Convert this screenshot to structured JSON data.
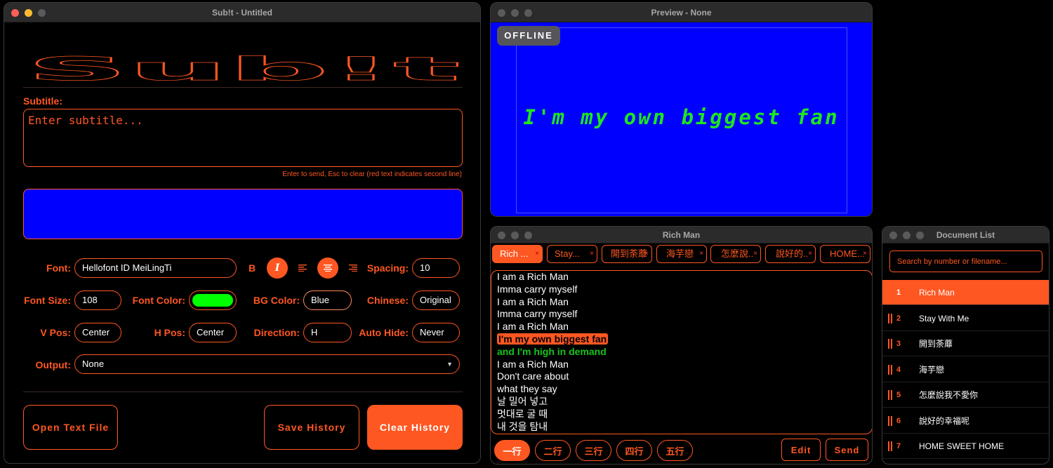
{
  "main_window": {
    "title": "Sub!t - Untitled",
    "logo_text": "Sub!t",
    "subtitle_label": "Subtitle:",
    "subtitle_placeholder": "Enter subtitle...",
    "hint": "Enter to send, Esc to clear (red text indicates second line)",
    "preview_color": "#0000ff",
    "fields": {
      "font_label": "Font:",
      "font_value": "Hellofont ID MeiLingTi",
      "bold_label": "B",
      "italic_label": "I",
      "spacing_label": "Spacing:",
      "spacing_value": "10",
      "font_size_label": "Font Size:",
      "font_size_value": "108",
      "font_color_label": "Font Color:",
      "font_color_value": "#00ff00",
      "bg_color_label": "BG Color:",
      "bg_color_value": "Blue",
      "chinese_label": "Chinese:",
      "chinese_value": "Original",
      "vpos_label": "V Pos:",
      "vpos_value": "Center",
      "hpos_label": "H Pos:",
      "hpos_value": "Center",
      "direction_label": "Direction:",
      "direction_value": "H",
      "autohide_label": "Auto Hide:",
      "autohide_value": "Never",
      "output_label": "Output:",
      "output_value": "None"
    },
    "buttons": {
      "open": "Open Text File",
      "save": "Save History",
      "clear": "Clear History"
    }
  },
  "preview_window": {
    "title": "Preview - None",
    "badge": "OFFLINE",
    "text": "I'm my own biggest fan",
    "bg_color": "#0000ff",
    "text_color": "#1ee61e"
  },
  "lyrics_window": {
    "title": "Rich Man",
    "tabs": [
      "Rich ...",
      "Stay...",
      "開到荼蘼",
      "海芋戀",
      "怎麼說..",
      "說好的..",
      "HOME..."
    ],
    "tab_close": "×",
    "lines": [
      {
        "text": "I am a Rich Man",
        "style": ""
      },
      {
        "text": "Imma carry myself",
        "style": ""
      },
      {
        "text": "I am a Rich Man",
        "style": ""
      },
      {
        "text": "Imma carry myself",
        "style": ""
      },
      {
        "text": "I am a Rich Man",
        "style": ""
      },
      {
        "text": "I'm my own biggest fan",
        "style": "hl"
      },
      {
        "text": "and I'm high in demand",
        "style": "green"
      },
      {
        "text": "I am a Rich Man",
        "style": ""
      },
      {
        "text": "Don't care about",
        "style": ""
      },
      {
        "text": "what they say",
        "style": ""
      },
      {
        "text": "날 밀어 넣고",
        "style": ""
      },
      {
        "text": "멋대로 굴 때",
        "style": ""
      },
      {
        "text": "내 것을 탐내",
        "style": ""
      }
    ],
    "line_buttons": [
      "一行",
      "二行",
      "三行",
      "四行",
      "五行"
    ],
    "edit": "Edit",
    "send": "Send"
  },
  "doc_window": {
    "title": "Document List",
    "search_placeholder": "Search by number or filename...",
    "items": [
      {
        "num": "1",
        "name": "Rich Man"
      },
      {
        "num": "2",
        "name": "Stay With Me"
      },
      {
        "num": "3",
        "name": "開到荼蘼"
      },
      {
        "num": "4",
        "name": "海芋戀"
      },
      {
        "num": "5",
        "name": "怎麼說我不愛你"
      },
      {
        "num": "6",
        "name": "說好的幸福呢"
      },
      {
        "num": "7",
        "name": "HOME SWEET HOME"
      }
    ]
  }
}
